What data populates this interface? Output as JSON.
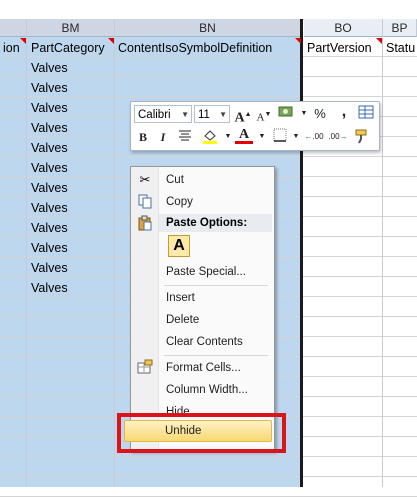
{
  "columns": {
    "headers": [
      {
        "label": "",
        "key": "bl"
      },
      {
        "label": "BM",
        "key": "bm"
      },
      {
        "label": "BN",
        "key": "bn"
      },
      {
        "label": "BO",
        "key": "bo"
      },
      {
        "label": "BP",
        "key": "bp"
      }
    ],
    "row1": [
      "ion",
      "PartCategory",
      "ContentIsoSymbolDefinition",
      "PartVersion",
      "Statu"
    ]
  },
  "cells": {
    "bm_values": [
      "Valves",
      "Valves",
      "Valves",
      "Valves",
      "Valves",
      "Valves",
      "Valves",
      "Valves",
      "Valves",
      "Valves",
      "Valves",
      "Valves"
    ]
  },
  "mini_toolbar": {
    "font_name": "Calibri",
    "font_size": "11",
    "grow_font": "A",
    "shrink_font": "A",
    "percent": "%",
    "comma": ",",
    "bold": "B",
    "italic": "I",
    "font_color_letter": "A",
    "inc_decimal": ".00",
    "dec_decimal": ".00"
  },
  "context_menu": {
    "cut": "Cut",
    "copy": "Copy",
    "paste_options": "Paste Options:",
    "paste_icon_letter": "A",
    "paste_special": "Paste Special...",
    "insert": "Insert",
    "delete": "Delete",
    "clear_contents": "Clear Contents",
    "format_cells": "Format Cells...",
    "column_width": "Column Width...",
    "hide": "Hide",
    "unhide": "Unhide"
  },
  "colors": {
    "selection": "#bdd7ee",
    "highlight": "#f8d973",
    "callout": "#d9141b"
  }
}
